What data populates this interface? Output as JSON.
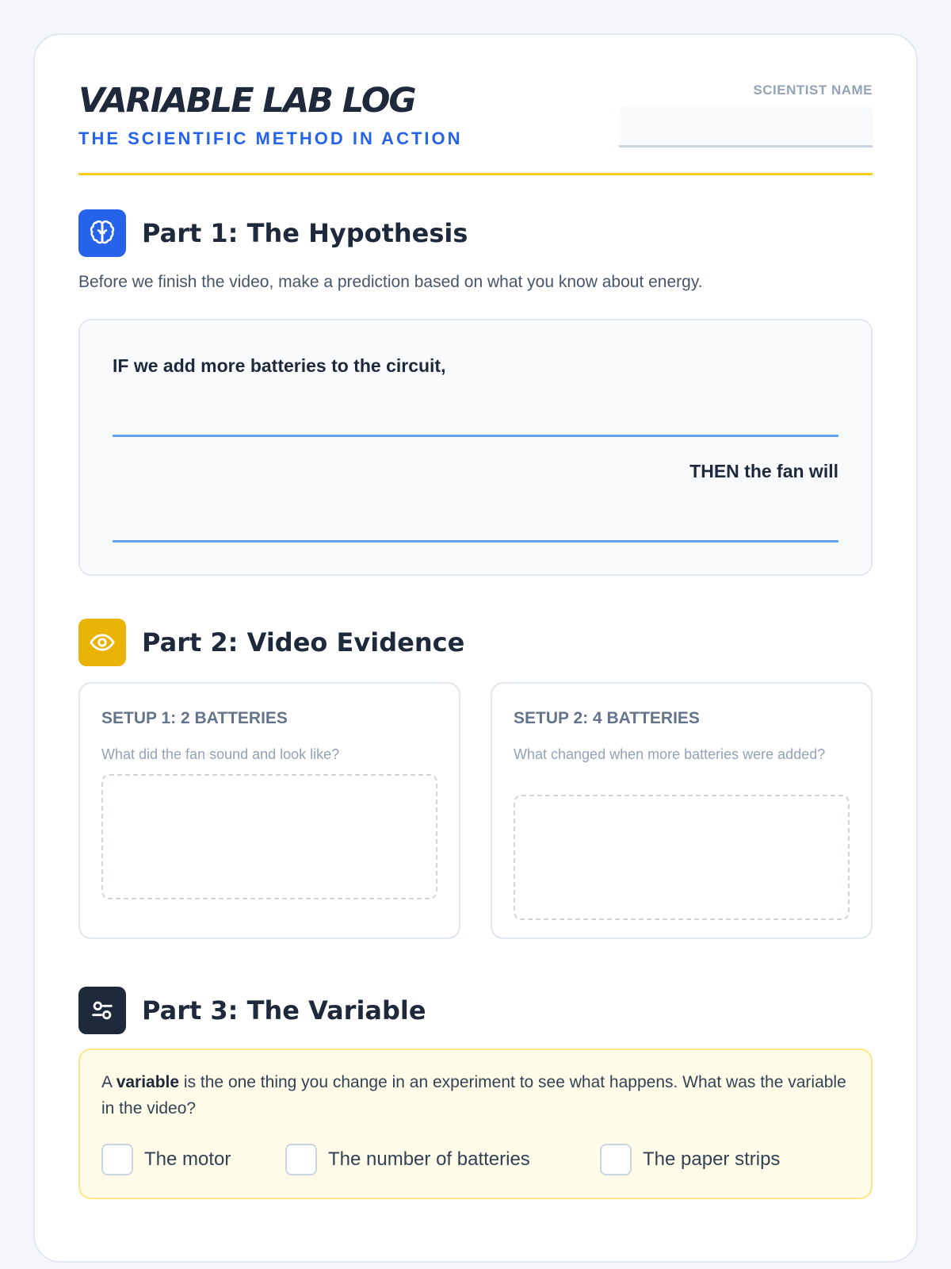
{
  "header": {
    "title": "VARIABLE LAB LOG",
    "subtitle": "THE SCIENTIFIC METHOD IN ACTION",
    "name_label": "SCIENTIST NAME",
    "name_value": ""
  },
  "part1": {
    "heading": "Part 1: The Hypothesis",
    "icon": "brain-icon",
    "intro": "Before we finish the video, make a prediction based on what you know about energy.",
    "if_text": "IF we add more batteries to the circuit,",
    "then_text": "THEN the fan will"
  },
  "part2": {
    "heading": "Part 2: Video Evidence",
    "icon": "eye-icon",
    "setups": [
      {
        "title": "SETUP 1: 2 BATTERIES",
        "prompt": "What did the fan sound and look like?"
      },
      {
        "title": "SETUP 2: 4 BATTERIES",
        "prompt": "What changed when more batteries were added?"
      }
    ]
  },
  "part3": {
    "heading": "Part 3: The Variable",
    "icon": "sliders-icon",
    "text_before": "A ",
    "text_bold": "variable",
    "text_after": " is the one thing you change in an experiment to see what happens. What was the variable in the video?",
    "options": [
      "The motor",
      "The number of batteries",
      "The paper strips"
    ]
  },
  "colors": {
    "accent_blue": "#2563eb",
    "accent_yellow": "#eab308",
    "dark": "#1e293b",
    "rule_yellow": "#facc15"
  }
}
